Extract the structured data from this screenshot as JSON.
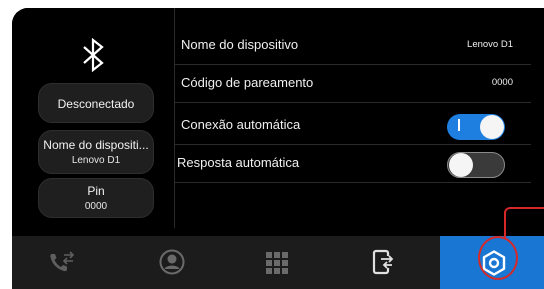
{
  "status": {
    "connection": "Desconectado"
  },
  "device_card": {
    "label": "Nome do dispositi...",
    "value": "Lenovo D1"
  },
  "pin_card": {
    "label": "Pin",
    "value": "0000"
  },
  "settings": [
    {
      "label": "Nome do dispositivo",
      "value": "Lenovo D1"
    },
    {
      "label": "Código de pareamento",
      "value": "0000"
    },
    {
      "label": "Conexão automática",
      "toggle_on": true
    },
    {
      "label": "Resposta automática",
      "toggle_on": false
    }
  ],
  "nav": {
    "items": [
      {
        "icon": "call-transfer-icon"
      },
      {
        "icon": "contact-icon"
      },
      {
        "icon": "dialpad-icon"
      },
      {
        "icon": "phone-transfer-icon"
      },
      {
        "icon": "settings-gear-icon",
        "active": true
      }
    ]
  },
  "colors": {
    "accent": "#1976d2",
    "toggle_on": "#1e7fe0",
    "callout": "#d62828",
    "background": "#000000"
  }
}
